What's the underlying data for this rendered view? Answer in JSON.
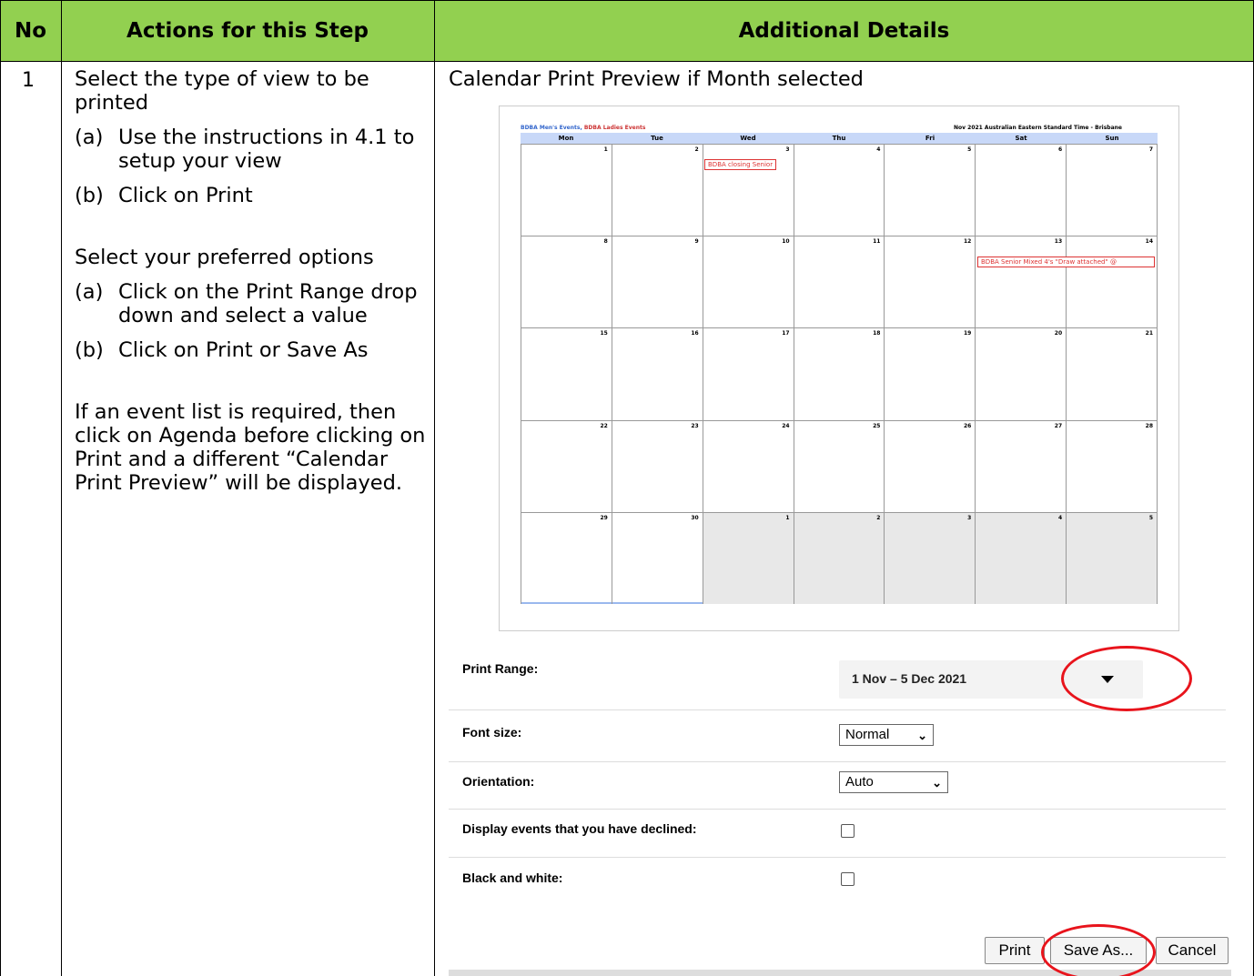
{
  "table": {
    "headers": [
      "No",
      "Actions for this Step",
      "Additional Details"
    ],
    "header_color": "#92d050"
  },
  "step": {
    "number": "1",
    "intro": "Select the type of view to be printed",
    "sub_a_label": "(a)",
    "sub_a_text": "Use the instructions in 4.1 to setup your view",
    "sub_b_label": "(b)",
    "sub_b_text": "Click on Print",
    "options_intro": "Select your preferred options",
    "opt_a_label": "(a)",
    "opt_a_text": "Click on the Print Range drop down and select a value",
    "opt_b_label": "(b)",
    "opt_b_text": "Click on Print or Save As",
    "agenda_note": "If an event list is required, then click on Agenda before clicking on Print and a different “Calendar Print Preview” will be displayed."
  },
  "details": {
    "title": "Calendar Print Preview if Month selected",
    "calendar": {
      "calendars_a": "BDBA Men's Events,",
      "calendars_b": "BDBA Ladies Events",
      "header_right": "Nov 2021 Australian Eastern Standard Time - Brisbane",
      "days": [
        "Mon",
        "Tue",
        "Wed",
        "Thu",
        "Fri",
        "Sat",
        "Sun"
      ],
      "weeks": [
        [
          "1",
          "2",
          "3",
          "4",
          "5",
          "6",
          "7"
        ],
        [
          "8",
          "9",
          "10",
          "11",
          "12",
          "13",
          "14"
        ],
        [
          "15",
          "16",
          "17",
          "18",
          "19",
          "20",
          "21"
        ],
        [
          "22",
          "23",
          "24",
          "25",
          "26",
          "27",
          "28"
        ],
        [
          "29",
          "30",
          "1",
          "2",
          "3",
          "4",
          "5"
        ]
      ],
      "event_1": "BDBA closing Senior",
      "event_2": "BDBA Senior Mixed 4's \"Draw attached\" @"
    },
    "options": {
      "print_range_label": "Print Range:",
      "print_range_value": "1 Nov – 5 Dec 2021",
      "font_size_label": "Font size:",
      "font_size_value": "Normal",
      "orientation_label": "Orientation:",
      "orientation_value": "Auto",
      "declined_label": "Display events that you have declined:",
      "bw_label": "Black and white:"
    },
    "buttons": {
      "print": "Print",
      "save_as": "Save As...",
      "cancel": "Cancel"
    },
    "highlight_color": "#e8141c"
  }
}
